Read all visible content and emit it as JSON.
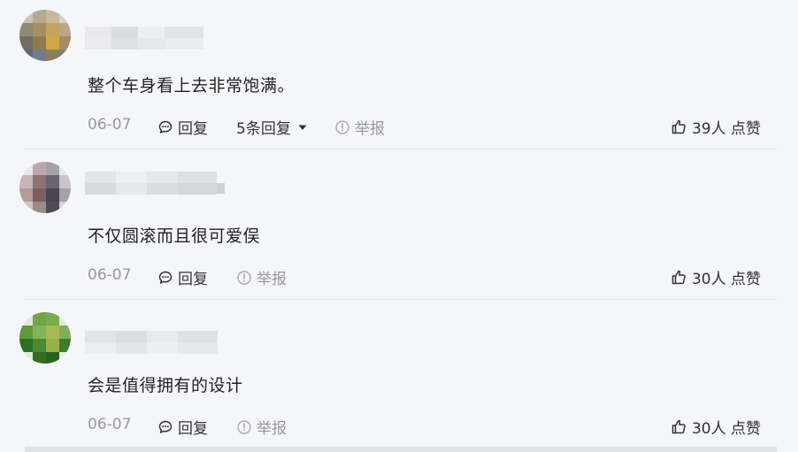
{
  "comments": [
    {
      "text": "整个车身看上去非常饱满。",
      "date": "06-07",
      "reply_label": "回复",
      "replies_label": "5条回复",
      "report_label": "举报",
      "likes_label": "39人 点赞"
    },
    {
      "text": "不仅圆滚而且很可爱俣",
      "date": "06-07",
      "reply_label": "回复",
      "report_label": "举报",
      "likes_label": "30人 点赞"
    },
    {
      "text": "会是值得拥有的设计",
      "date": "06-07",
      "reply_label": "回复",
      "report_label": "举报",
      "likes_label": "30人 点赞"
    }
  ],
  "icons": {
    "reply": "speech-bubble-icon",
    "expand": "caret-down-icon",
    "report": "warning-circle-icon",
    "like": "thumbs-up-icon"
  },
  "colors": {
    "background": "#f5f6fa",
    "text": "#222222",
    "muted": "#999999",
    "divider": "#e3e4e8"
  }
}
